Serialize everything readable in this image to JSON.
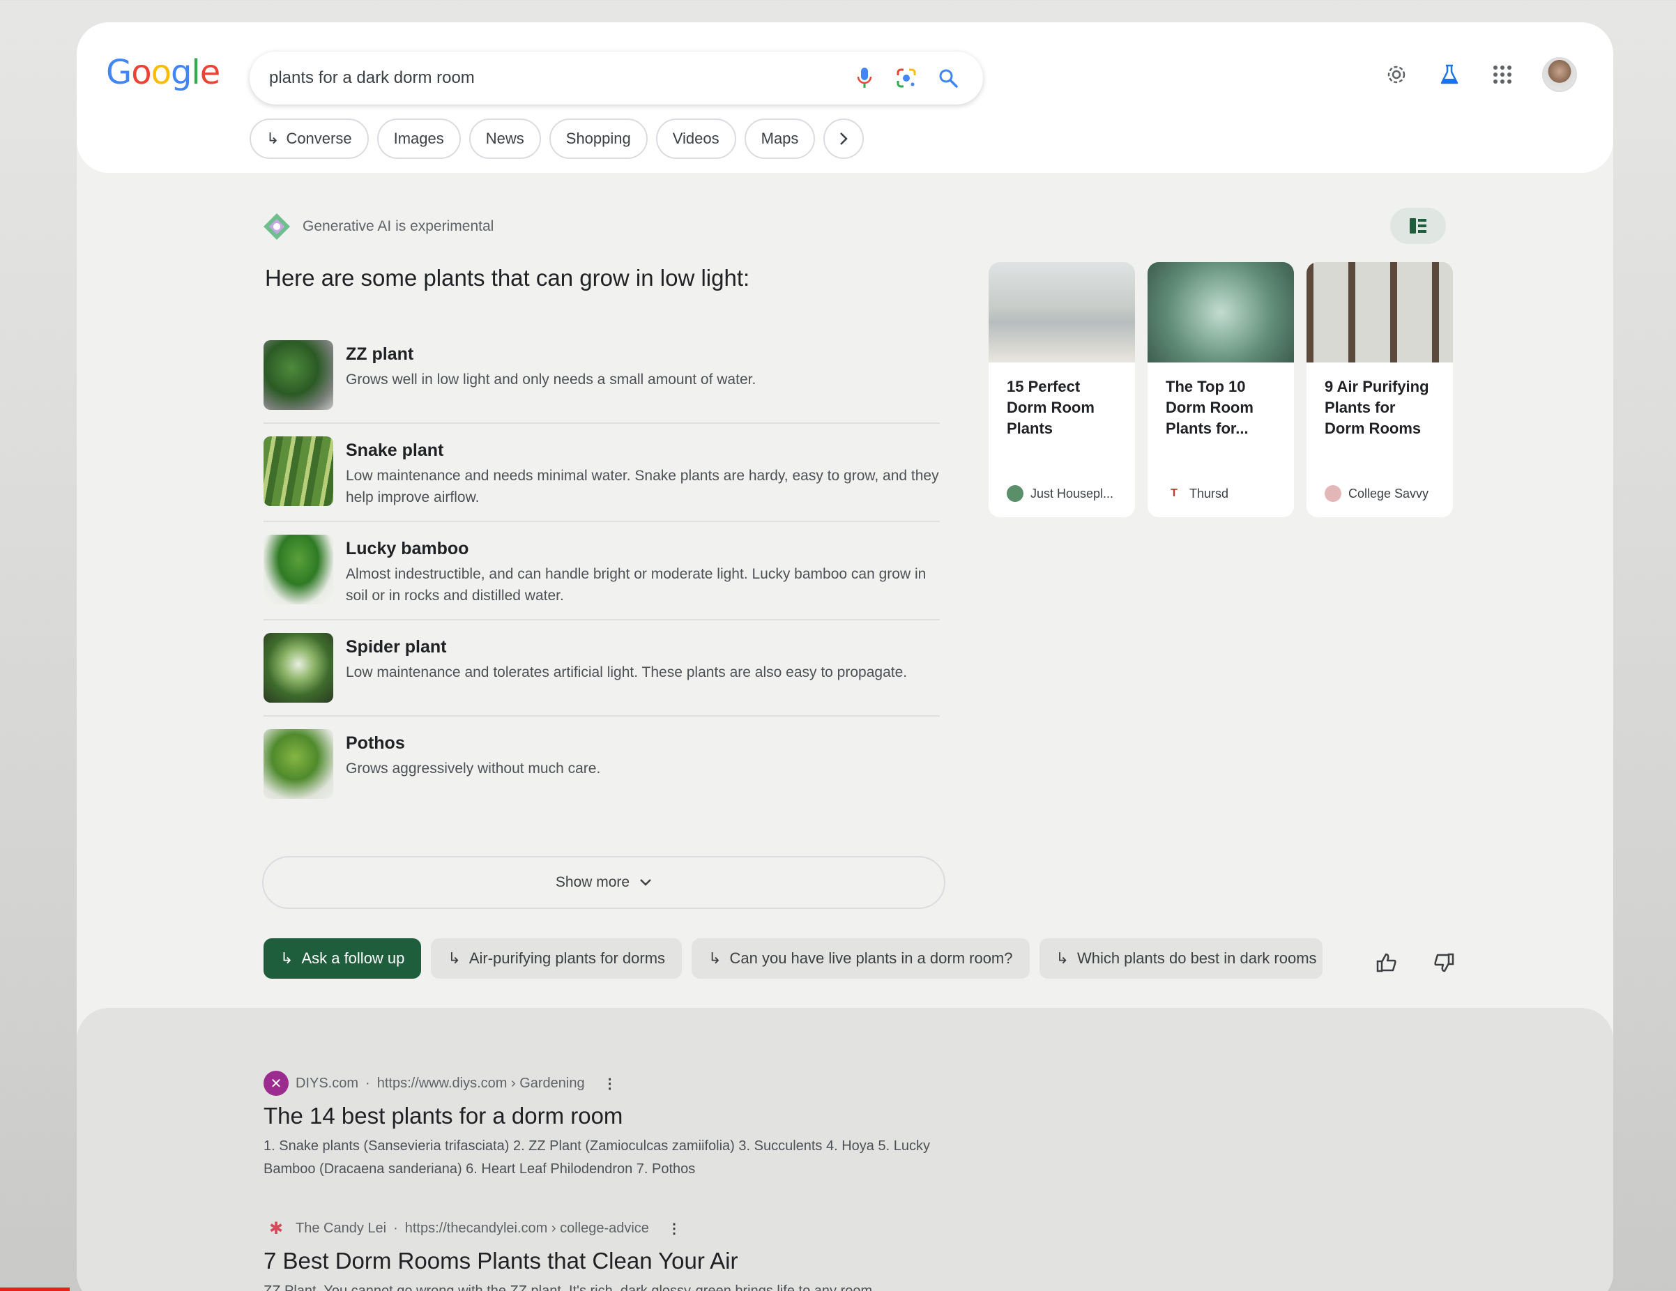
{
  "header": {
    "logo_letters": [
      {
        "ch": "G",
        "color": "#4285F4"
      },
      {
        "ch": "o",
        "color": "#EA4335"
      },
      {
        "ch": "o",
        "color": "#FBBC05"
      },
      {
        "ch": "g",
        "color": "#4285F4"
      },
      {
        "ch": "l",
        "color": "#34A853"
      },
      {
        "ch": "e",
        "color": "#EA4335"
      }
    ],
    "search_query": "plants for a dark dorm room",
    "icons": [
      "mic-icon",
      "lens-icon",
      "search-icon",
      "gear-icon",
      "labs-flask-icon",
      "apps-grid-icon",
      "avatar"
    ]
  },
  "tabs": {
    "converse": "Converse",
    "images": "Images",
    "news": "News",
    "shopping": "Shopping",
    "videos": "Videos",
    "maps": "Maps"
  },
  "ai": {
    "badge": "Generative AI is experimental",
    "intro": "Here are some plants that can grow in low light:",
    "plants": [
      {
        "name": "ZZ plant",
        "desc": "Grows well in low light and only needs a small amount of water."
      },
      {
        "name": "Snake plant",
        "desc": "Low maintenance and needs minimal water. Snake plants are hardy, easy to grow, and they help improve airflow."
      },
      {
        "name": "Lucky bamboo",
        "desc": "Almost indestructible, and can handle bright or moderate light. Lucky bamboo can grow in soil or in rocks and distilled water."
      },
      {
        "name": "Spider plant",
        "desc": "Low maintenance and tolerates artificial light. These plants are also easy to propagate."
      },
      {
        "name": "Pothos",
        "desc": "Grows aggressively without much care."
      }
    ],
    "show_more": "Show more"
  },
  "cards": [
    {
      "title": "15 Perfect Dorm Room Plants",
      "source": "Just Housepl...",
      "dot_color": "#5a8f6a"
    },
    {
      "title": "The Top 10 Dorm Room Plants for...",
      "source": "Thursd",
      "dot_color": "#c0392b"
    },
    {
      "title": "9 Air Purifying Plants for Dorm Rooms",
      "source": "College Savvy",
      "dot_color": "#e3b7b7"
    }
  ],
  "followups": {
    "ask": "Ask a follow up",
    "q1": "Air-purifying plants for dorms",
    "q2": "Can you have live plants in a dorm room?",
    "q3": "Which plants do best in dark rooms"
  },
  "results": [
    {
      "site": "DIYS.com",
      "url": "https://www.diys.com › Gardening",
      "title": "The 14 best plants for a dorm room",
      "snippet": "1. Snake plants (Sansevieria trifasciata) 2. ZZ Plant (Zamioculcas zamiifolia) 3. Succulents 4. Hoya 5. Lucky Bamboo (Dracaena sanderiana) 6. Heart Leaf Philodendron 7. Pothos"
    },
    {
      "site": "The Candy Lei",
      "url": "https://thecandylei.com › college-advice",
      "title": "7 Best Dorm Rooms Plants that Clean Your Air",
      "snippet": "ZZ Plant. You cannot go wrong with the ZZ plant. It's rich, dark glossy-green brings life to any room."
    }
  ],
  "separator": "·",
  "menu_dots": "⋮"
}
